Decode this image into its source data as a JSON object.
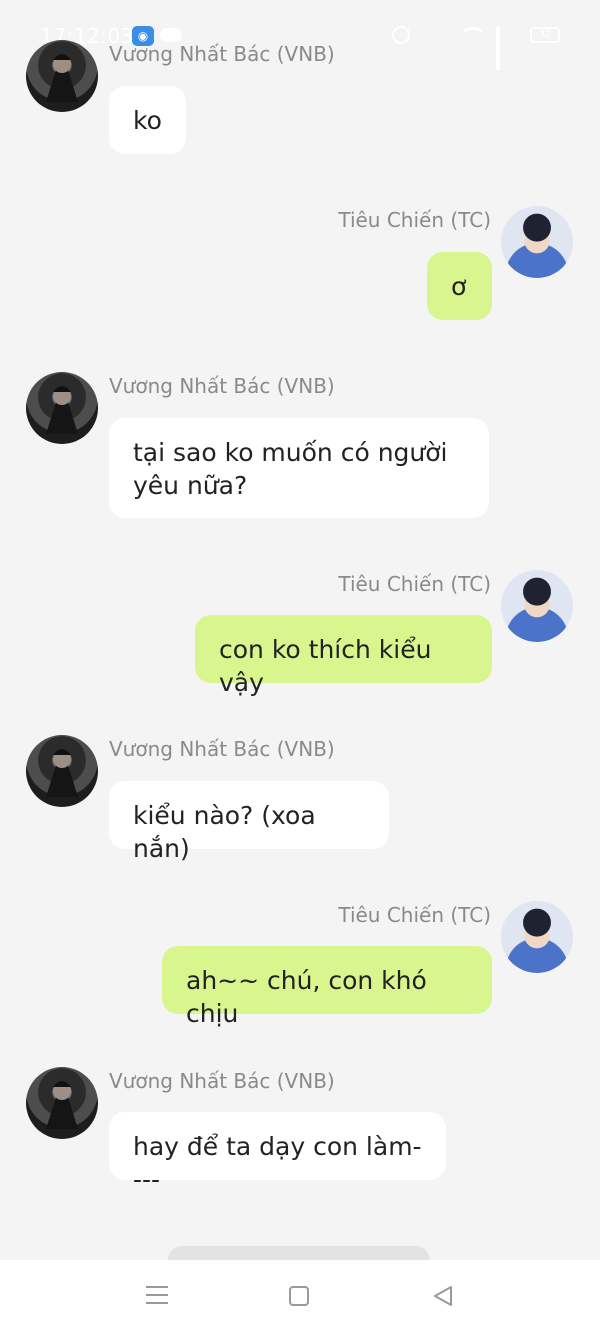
{
  "status_bar": {
    "time": "17:12:03",
    "app_icon": "notification-app-icon",
    "battery": "32"
  },
  "messages": [
    {
      "sender": "Vương Nhất Bác (VNB)",
      "side": "left",
      "text": "ko",
      "avatar": "vnb-avatar"
    },
    {
      "sender": "Tiêu Chiến (TC)",
      "side": "right",
      "text": "ơ",
      "avatar": "tc-avatar"
    },
    {
      "sender": "Vương Nhất Bác (VNB)",
      "side": "left",
      "text_line1": "tại sao ko muốn có người",
      "text_line2": "yêu nữa?",
      "avatar": "vnb-avatar"
    },
    {
      "sender": "Tiêu Chiến (TC)",
      "side": "right",
      "text": "con ko thích kiểu vậy",
      "avatar": "tc-avatar"
    },
    {
      "sender": "Vương Nhất Bác (VNB)",
      "side": "left",
      "text": "kiểu nào? (xoa nắn)",
      "avatar": "vnb-avatar"
    },
    {
      "sender": "Tiêu Chiến (TC)",
      "side": "right",
      "text": "ah~~ chú, con khó chịu",
      "avatar": "tc-avatar"
    },
    {
      "sender": "Vương Nhất Bác (VNB)",
      "side": "left",
      "text": "hay để ta dạy con làm----",
      "avatar": "vnb-avatar"
    }
  ],
  "colors": {
    "background": "#f4f4f4",
    "left_bubble": "#ffffff",
    "right_bubble": "#d9f58d",
    "sender_text": "#8a8a8a"
  },
  "nav_bar": {
    "menu": "menu-icon",
    "home": "home-square-icon",
    "back": "back-triangle-icon"
  }
}
